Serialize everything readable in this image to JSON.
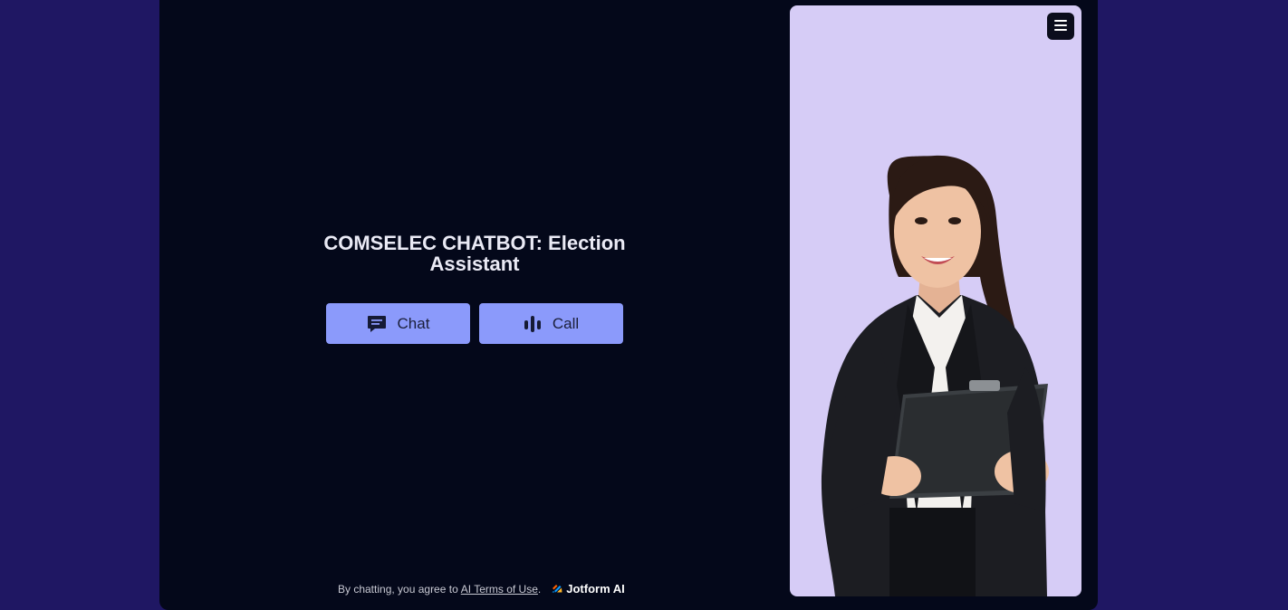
{
  "title": "COMSELEC CHATBOT: Election Assistant",
  "buttons": {
    "chat_label": "Chat",
    "call_label": "Call"
  },
  "footer": {
    "prefix": "By chatting, you agree to",
    "terms_link": "AI Terms of Use",
    "period": ".",
    "brand": "Jotform AI"
  },
  "icons": {
    "chat": "chat-bubble-icon",
    "call": "audio-bars-icon",
    "menu": "hamburger-menu-icon",
    "brand": "jotform-logo-icon"
  },
  "colors": {
    "outer_background": "#1f1763",
    "container_background": "#04081a",
    "button_background": "#8b9afb",
    "avatar_background": "#d6ccf6"
  }
}
